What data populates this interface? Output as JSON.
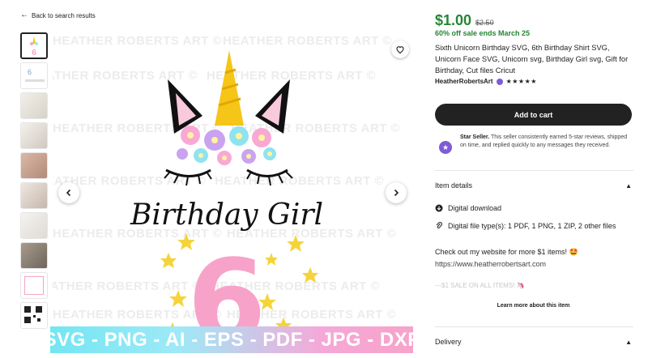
{
  "nav": {
    "back_label": "Back to search results"
  },
  "gallery": {
    "thumbnail_count": 10,
    "watermark_text": "HEATHER ROBERTS ART ©",
    "artwork": {
      "headline": "Birthday Girl",
      "number": "6"
    },
    "formats_banner": "SVG - PNG - AI - EPS - PDF - JPG - DXF"
  },
  "listing": {
    "price": "$1.00",
    "original_price": "$2.50",
    "sale_text": "60% off sale ends March 25",
    "title": "Sixth Unicorn Birthday SVG, 6th Birthday Shirt SVG, Unicorn Face SVG, Unicorn svg, Birthday Girl svg, Gift for Birthday, Cut files Cricut",
    "shop_name": "HeatherRobertsArt",
    "rating_stars": "★★★★★",
    "rating": 5,
    "add_to_cart_label": "Add to cart",
    "star_seller": {
      "title": "Star Seller.",
      "text": "This seller consistently earned 5-star reviews, shipped on time, and replied quickly to any messages they received."
    },
    "item_details": {
      "heading": "Item details",
      "download_label": "Digital download",
      "file_types_label": "Digital file type(s): 1 PDF, 1 PNG, 1 ZIP, 2 other files",
      "description_line1": "Check out my website for more $1 items! 🤩",
      "description_url": "https://www.heatherrobertsart.com",
      "faded_line": "---$1 SALE ON ALL ITEMS! 🦄",
      "learn_more_label": "Learn more about this item"
    },
    "delivery": {
      "heading": "Delivery"
    }
  },
  "colors": {
    "price_green": "#258635",
    "star_seller_purple": "#7f5bd5",
    "button_dark": "#222222",
    "pink": "#f7a3c9",
    "cyan": "#73e6f2"
  }
}
